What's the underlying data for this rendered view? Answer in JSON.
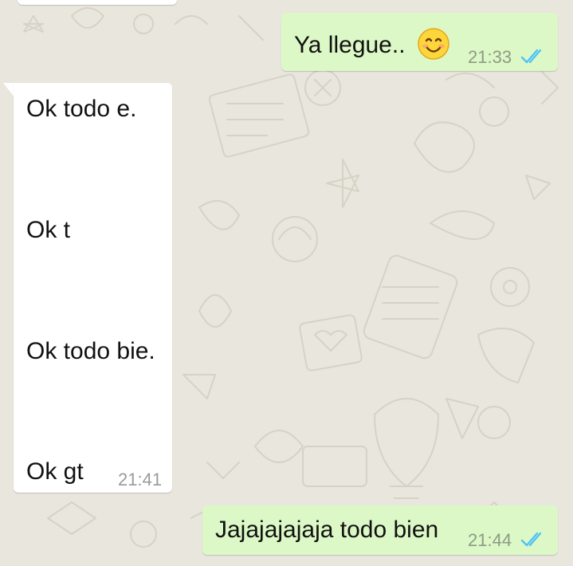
{
  "colors": {
    "wallpaper": "#e9e6dd",
    "outgoing_bubble": "#dcf8c6",
    "incoming_bubble": "#ffffff",
    "read_ticks": "#4fc3f7"
  },
  "messages": [
    {
      "direction": "outgoing",
      "text": "Ya llegue..",
      "emoji": "smiling-face-icon",
      "time": "21:33",
      "status": "read-double-check-icon"
    },
    {
      "direction": "incoming",
      "lines": [
        "Ok todo e.",
        "Ok t",
        "Ok todo bie.",
        "Ok gt"
      ],
      "time": "21:41"
    },
    {
      "direction": "outgoing",
      "text": "Jajajajajaja todo bien",
      "time": "21:44",
      "status": "read-double-check-icon"
    }
  ]
}
